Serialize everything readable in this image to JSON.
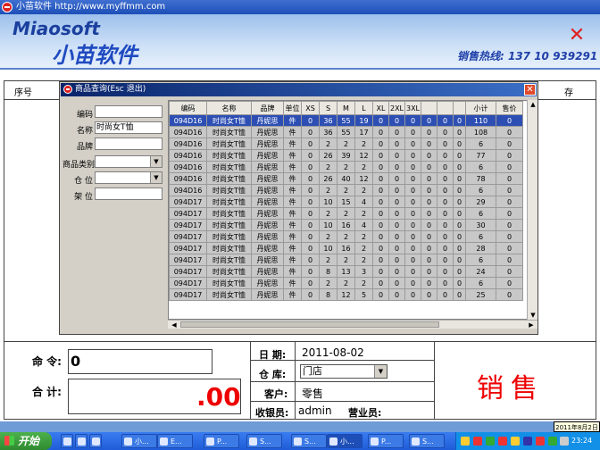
{
  "window": {
    "title": "小苗软件 http://www.myffmm.com"
  },
  "header": {
    "logo_en": "Miaosoft",
    "logo_cn": "小苗软件",
    "hotline": "销售热线: 137 10 939291",
    "close_glyph": "✕"
  },
  "main_table": {
    "col_seq": "序号",
    "col_right": "存"
  },
  "dialog": {
    "title": "商品查询(Esc 退出)",
    "close_glyph": "✕",
    "filters": {
      "code_label": "编码",
      "code_value": "",
      "name_label": "名称",
      "name_value": "时尚女T恤",
      "brand_label": "品牌",
      "brand_value": "",
      "category_label": "商品类别",
      "category_value": "",
      "warehouse_label": "仓 位",
      "warehouse_value": "",
      "shelf_label": "架 位",
      "shelf_value": ""
    },
    "columns": [
      "编码",
      "名称",
      "品牌",
      "单位",
      "XS",
      "S",
      "M",
      "L",
      "XL",
      "2XL",
      "3XL",
      "",
      "",
      "",
      "小计",
      "售价"
    ],
    "rows": [
      [
        "094D16",
        "时尚女T恤",
        "丹妮思",
        "件",
        "0",
        "36",
        "55",
        "19",
        "0",
        "0",
        "0",
        "0",
        "0",
        "0",
        "110",
        "0"
      ],
      [
        "094D16",
        "时尚女T恤",
        "丹妮思",
        "件",
        "0",
        "36",
        "55",
        "17",
        "0",
        "0",
        "0",
        "0",
        "0",
        "0",
        "108",
        "0"
      ],
      [
        "094D16",
        "时尚女T恤",
        "丹妮思",
        "件",
        "0",
        "2",
        "2",
        "2",
        "0",
        "0",
        "0",
        "0",
        "0",
        "0",
        "6",
        "0"
      ],
      [
        "094D16",
        "时尚女T恤",
        "丹妮思",
        "件",
        "0",
        "26",
        "39",
        "12",
        "0",
        "0",
        "0",
        "0",
        "0",
        "0",
        "77",
        "0"
      ],
      [
        "094D16",
        "时尚女T恤",
        "丹妮思",
        "件",
        "0",
        "2",
        "2",
        "2",
        "0",
        "0",
        "0",
        "0",
        "0",
        "0",
        "6",
        "0"
      ],
      [
        "094D16",
        "时尚女T恤",
        "丹妮思",
        "件",
        "0",
        "26",
        "40",
        "12",
        "0",
        "0",
        "0",
        "0",
        "0",
        "0",
        "78",
        "0"
      ],
      [
        "094D16",
        "时尚女T恤",
        "丹妮思",
        "件",
        "0",
        "2",
        "2",
        "2",
        "0",
        "0",
        "0",
        "0",
        "0",
        "0",
        "6",
        "0"
      ],
      [
        "094D17",
        "时尚女T恤",
        "丹妮思",
        "件",
        "0",
        "10",
        "15",
        "4",
        "0",
        "0",
        "0",
        "0",
        "0",
        "0",
        "29",
        "0"
      ],
      [
        "094D17",
        "时尚女T恤",
        "丹妮思",
        "件",
        "0",
        "2",
        "2",
        "2",
        "0",
        "0",
        "0",
        "0",
        "0",
        "0",
        "6",
        "0"
      ],
      [
        "094D17",
        "时尚女T恤",
        "丹妮思",
        "件",
        "0",
        "10",
        "16",
        "4",
        "0",
        "0",
        "0",
        "0",
        "0",
        "0",
        "30",
        "0"
      ],
      [
        "094D17",
        "时尚女T恤",
        "丹妮思",
        "件",
        "0",
        "2",
        "2",
        "2",
        "0",
        "0",
        "0",
        "0",
        "0",
        "0",
        "6",
        "0"
      ],
      [
        "094D17",
        "时尚女T恤",
        "丹妮思",
        "件",
        "0",
        "10",
        "16",
        "2",
        "0",
        "0",
        "0",
        "0",
        "0",
        "0",
        "28",
        "0"
      ],
      [
        "094D17",
        "时尚女T恤",
        "丹妮思",
        "件",
        "0",
        "2",
        "2",
        "2",
        "0",
        "0",
        "0",
        "0",
        "0",
        "0",
        "6",
        "0"
      ],
      [
        "094D17",
        "时尚女T恤",
        "丹妮思",
        "件",
        "0",
        "8",
        "13",
        "3",
        "0",
        "0",
        "0",
        "0",
        "0",
        "0",
        "24",
        "0"
      ],
      [
        "094D17",
        "时尚女T恤",
        "丹妮思",
        "件",
        "0",
        "2",
        "2",
        "2",
        "0",
        "0",
        "0",
        "0",
        "0",
        "0",
        "6",
        "0"
      ],
      [
        "094D17",
        "时尚女T恤",
        "丹妮思",
        "件",
        "0",
        "8",
        "12",
        "5",
        "0",
        "0",
        "0",
        "0",
        "0",
        "0",
        "25",
        "0"
      ]
    ],
    "selected_row": 0
  },
  "bottom": {
    "cmd_label": "命 令:",
    "cmd_value": "0",
    "sum_label": "合 计:",
    "sum_value": ".00",
    "date_label": "日 期:",
    "date_value": "2011-08-02",
    "warehouse_label": "仓 库:",
    "warehouse_value": "门店",
    "customer_label": "客户:",
    "customer_value": "零售",
    "cashier_label": "收银员:",
    "cashier_value": "admin",
    "clerk_label": "营业员:",
    "clerk_value": "",
    "mode_text": "销售"
  },
  "tooltip": {
    "date": "2011年8月2日"
  },
  "taskbar": {
    "start_label": "开始",
    "items": [
      "小...",
      "E...",
      "P...",
      "S...",
      "S...",
      "小...",
      "P...",
      "S..."
    ],
    "clock": "23:24"
  }
}
